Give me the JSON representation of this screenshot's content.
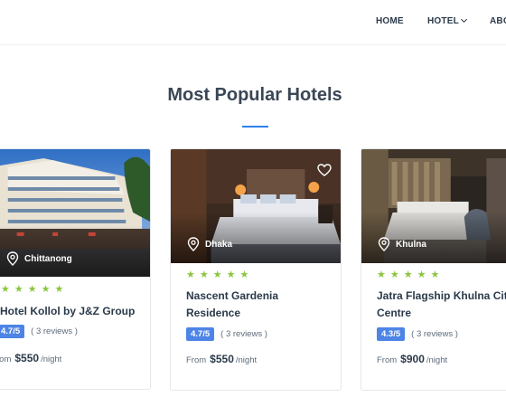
{
  "nav": {
    "home": "HOME",
    "hotel": "HOTEL",
    "about": "ABO"
  },
  "section": {
    "title": "Most Popular Hotels"
  },
  "hotels": [
    {
      "location": "Chittanong",
      "stars": "★★★★★",
      "name": "Hotel Kollol by J&Z Group",
      "name_line2": "",
      "rating": "4.7/5",
      "reviews": "( 3 reviews )",
      "from": "rom",
      "price": "$550",
      "per": "/night"
    },
    {
      "location": "Dhaka",
      "stars": "★★★★★",
      "name": "Nascent Gardenia",
      "name_line2": "Residence",
      "rating": "4.7/5",
      "reviews": "( 3 reviews )",
      "from": "From",
      "price": "$550",
      "per": "/night"
    },
    {
      "location": "Khulna",
      "stars": "★★★★★",
      "name": "Jatra Flagship Khulna Cit",
      "name_line2": "Centre",
      "rating": "4.3/5",
      "reviews": "( 3 reviews )",
      "from": "From",
      "price": "$900",
      "per": "/night"
    }
  ],
  "colors": {
    "accent": "#2f80ed",
    "stars": "#8cc63f",
    "badge": "#4d84e6",
    "text": "#2b3a4a"
  },
  "icons": {
    "location": "map-pin-icon",
    "favorite": "heart-icon",
    "dropdown": "chevron-down-icon"
  }
}
